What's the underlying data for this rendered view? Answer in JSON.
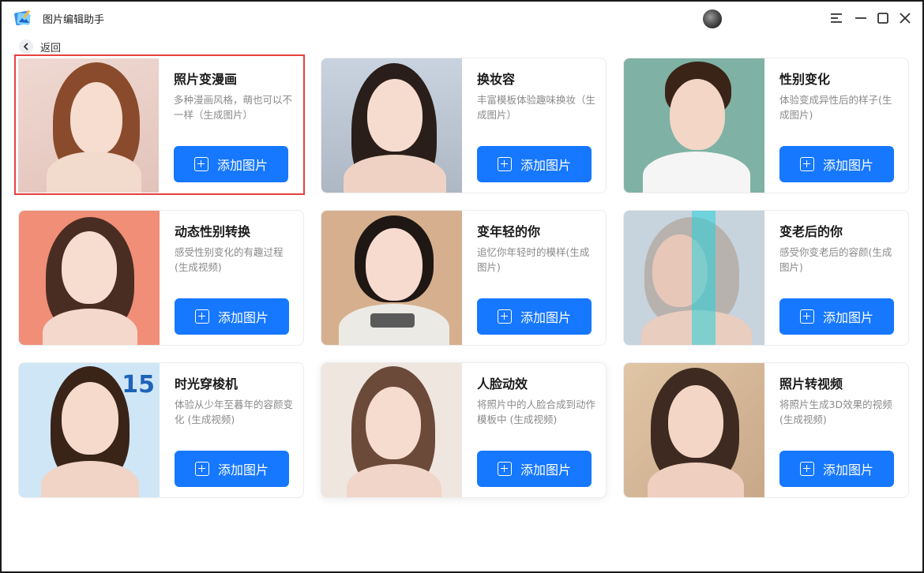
{
  "app": {
    "title": "图片编辑助手"
  },
  "nav": {
    "back_label": "返回"
  },
  "colors": {
    "accent": "#1677ff",
    "selected_border": "#e8403f"
  },
  "cards": [
    {
      "title": "照片变漫画",
      "desc": "多种漫画风格，萌也可以不一样（生成图片）",
      "button": "添加图片",
      "selected": true
    },
    {
      "title": "换妆容",
      "desc": "丰富模板体验趣味换妆（生成图片）",
      "button": "添加图片"
    },
    {
      "title": "性别变化",
      "desc": "体验变成异性后的样子(生成图片)",
      "button": "添加图片"
    },
    {
      "title": "动态性别转换",
      "desc": "感受性别变化的有趣过程(生成视频)",
      "button": "添加图片"
    },
    {
      "title": "变年轻的你",
      "desc": "追忆你年轻时的模样(生成图片)",
      "button": "添加图片"
    },
    {
      "title": "变老后的你",
      "desc": "感受你变老后的容颜(生成图片)",
      "button": "添加图片"
    },
    {
      "title": "时光穿梭机",
      "desc": "体验从少年至暮年的容颜变化 (生成视频)",
      "button": "添加图片",
      "badge": "15"
    },
    {
      "title": "人脸动效",
      "desc": "将照片中的人脸合成到动作模板中 (生成视频)",
      "button": "添加图片"
    },
    {
      "title": "照片转视频",
      "desc": "将照片生成3D效果的视频 (生成视频)",
      "button": "添加图片"
    }
  ]
}
